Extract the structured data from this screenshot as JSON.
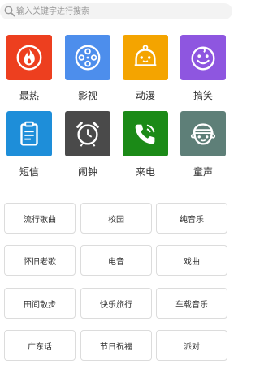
{
  "search": {
    "placeholder": "输入关键字进行搜索"
  },
  "categories": [
    {
      "label": "最热",
      "icon": "fire-icon",
      "color": "#ed3f1f"
    },
    {
      "label": "影视",
      "icon": "film-reel-icon",
      "color": "#4d8eec"
    },
    {
      "label": "动漫",
      "icon": "bell-face-icon",
      "color": "#f4a400"
    },
    {
      "label": "搞笑",
      "icon": "smiley-face-icon",
      "color": "#8e56e0"
    },
    {
      "label": "短信",
      "icon": "clipboard-icon",
      "color": "#1e8ed9"
    },
    {
      "label": "闹钟",
      "icon": "alarm-clock-icon",
      "color": "#4a4a4a"
    },
    {
      "label": "来电",
      "icon": "phone-ringing-icon",
      "color": "#1b8a17"
    },
    {
      "label": "童声",
      "icon": "child-face-icon",
      "color": "#5e7f78"
    }
  ],
  "tags": [
    "流行歌曲",
    "校园",
    "纯音乐",
    "怀旧老歌",
    "电音",
    "戏曲",
    "田间散步",
    "快乐旅行",
    "车载音乐",
    "广东话",
    "节日祝福",
    "派对"
  ]
}
